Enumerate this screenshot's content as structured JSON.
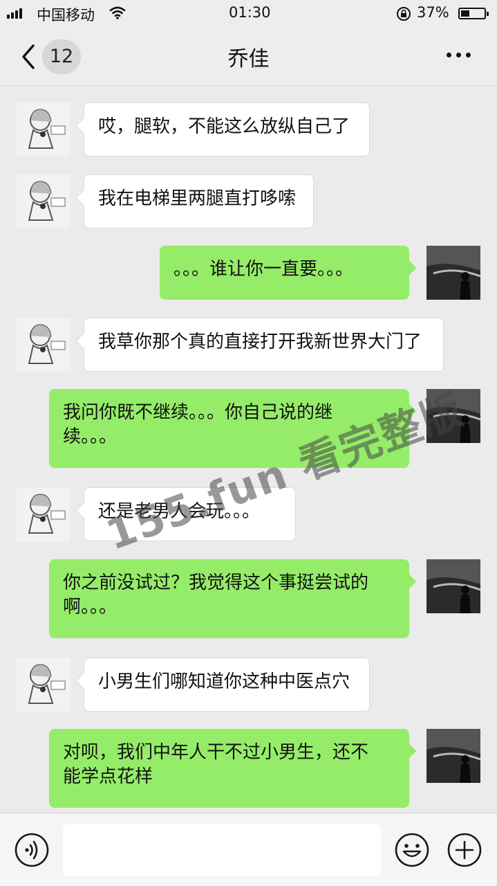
{
  "status_bar": {
    "carrier": "中国移动",
    "time": "01:30",
    "battery_percent": "37%",
    "battery_level": 0.37
  },
  "header": {
    "unread_count": "12",
    "title": "乔佳"
  },
  "messages": [
    {
      "side": "left",
      "text": "哎，腿软，不能这么放纵自己了"
    },
    {
      "side": "left",
      "text": "我在电梯里两腿直打哆嗦"
    },
    {
      "side": "right",
      "text": "。。。谁让你一直要。。。"
    },
    {
      "side": "left",
      "text": "我草你那个真的直接打开我新世界大门了"
    },
    {
      "side": "right",
      "text": "我问你既不继续。。。你自己说的继续。。。"
    },
    {
      "side": "left",
      "text": "还是老男人会玩。。。"
    },
    {
      "side": "right",
      "text": "你之前没试过？我觉得这个事挺尝试的啊。。。"
    },
    {
      "side": "left",
      "text": "小男生们哪知道你这种中医点穴"
    },
    {
      "side": "right",
      "text": "对呗，我们中年人干不过小男生，还不能学点花样"
    }
  ],
  "watermark": "155.fun 看完整版",
  "input_bar": {
    "text_value": ""
  },
  "colors": {
    "self_bubble": "#95ec69",
    "friend_bubble": "#ffffff",
    "background": "#ebebeb"
  },
  "icons": [
    "signal-icon",
    "wifi-icon",
    "rotation-lock-icon",
    "battery-icon",
    "back-chevron-icon",
    "more-icon",
    "voice-icon",
    "emoji-icon",
    "plus-icon"
  ]
}
